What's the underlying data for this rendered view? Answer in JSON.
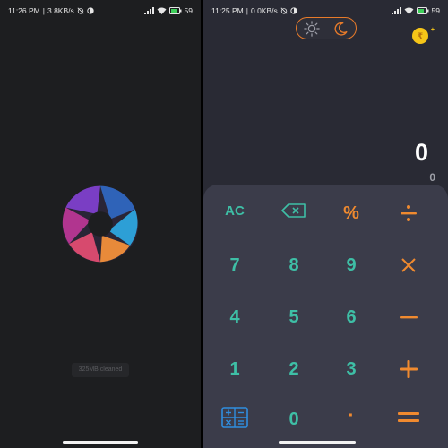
{
  "left_screen": {
    "status": {
      "time": "11:26 PM",
      "separator": "|",
      "speed": "3.8KB/s",
      "battery": "59"
    },
    "toast": "325MB cleaned"
  },
  "right_screen": {
    "status": {
      "time": "11:25 PM",
      "separator": "|",
      "speed": "0.0KB/s",
      "battery": "59"
    },
    "coin_symbol": "₹",
    "coin_plus": "+",
    "display": {
      "main": "0",
      "sub": "0"
    },
    "keys": {
      "ac": "AC",
      "percent": "%",
      "seven": "7",
      "eight": "8",
      "nine": "9",
      "four": "4",
      "five": "5",
      "six": "6",
      "one": "1",
      "two": "2",
      "three": "3",
      "zero": "0",
      "dot": "·"
    }
  },
  "colors": {
    "accent_teal": "#3ebfa6",
    "accent_orange": "#f08a2f",
    "keypad_bg": "#3b3c4a",
    "screen_bg": "#292a34"
  }
}
